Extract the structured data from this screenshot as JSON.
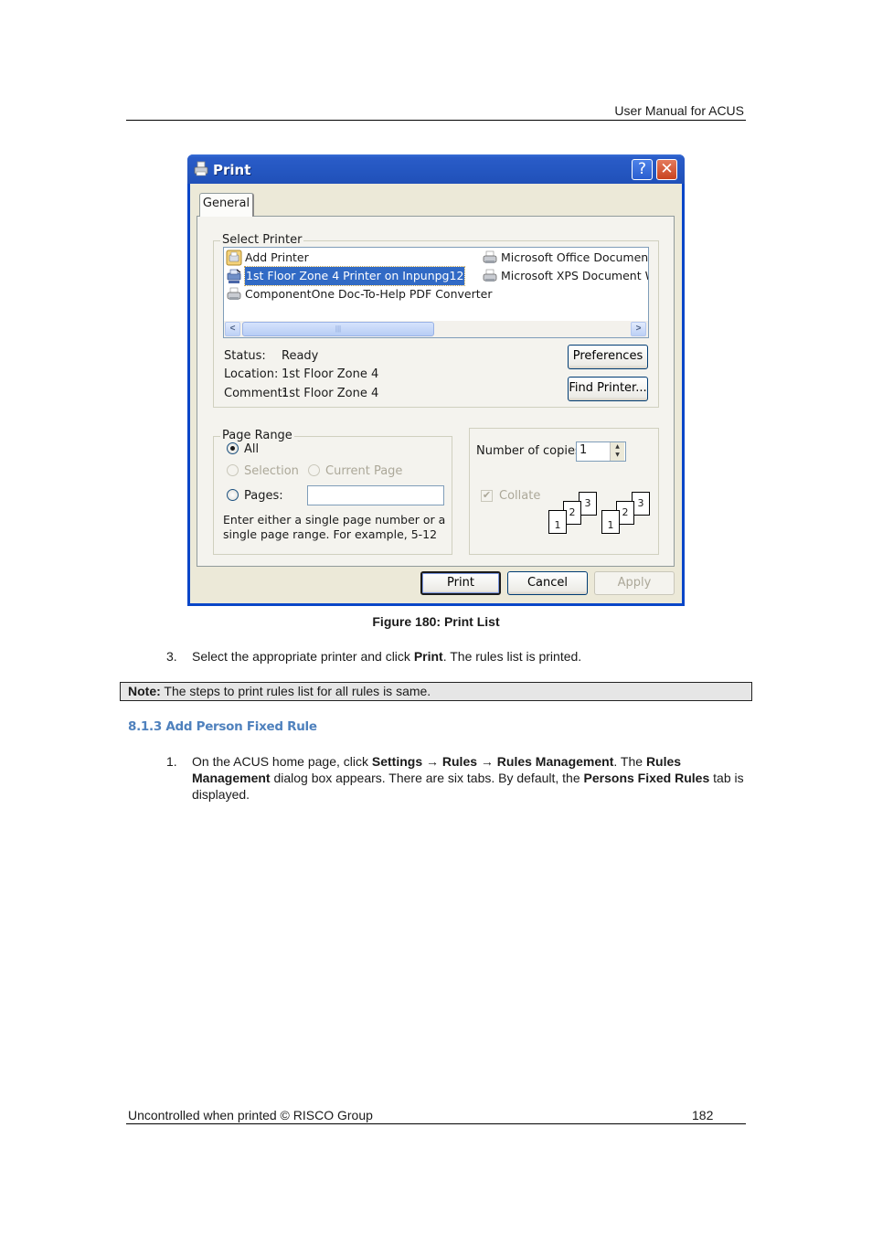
{
  "page_header": {
    "title": "User Manual for ACUS"
  },
  "dialog": {
    "title": "Print",
    "help_button": "?",
    "close_button": "✕",
    "tabs": [
      {
        "label": "General",
        "active": true
      }
    ],
    "select_printer": {
      "group_label": "Select Printer",
      "printers": [
        {
          "name": "Add Printer",
          "icon": "add-printer-icon",
          "selected": false
        },
        {
          "name": "1st Floor Zone 4 Printer on Inpunpg12",
          "icon": "network-printer-icon",
          "selected": true
        },
        {
          "name": "ComponentOne Doc-To-Help PDF Converter",
          "icon": "printer-icon",
          "selected": false
        },
        {
          "name": "Microsoft Office Document I",
          "icon": "printer-icon",
          "selected": false
        },
        {
          "name": "Microsoft XPS Document Wri",
          "icon": "printer-icon",
          "selected": false
        }
      ],
      "scroll_left": "<",
      "scroll_right": ">",
      "scroll_grip": "|||",
      "status_label": "Status:",
      "status_value": "Ready",
      "location_label": "Location:",
      "location_value": "1st Floor Zone 4",
      "comment_label": "Comment:",
      "comment_value": "1st Floor Zone 4",
      "preferences_button": "Preferences",
      "find_printer_button": "Find Printer..."
    },
    "page_range": {
      "group_label": "Page Range",
      "all_label": "All",
      "selection_label": "Selection",
      "current_page_label": "Current Page",
      "pages_label": "Pages:",
      "pages_value": "",
      "selected_option": "All",
      "hint": "Enter either a single page number or a single page range.  For example, 5-12"
    },
    "copies": {
      "number_label": "Number of copies:",
      "number_value": "1",
      "collate_label": "Collate",
      "collate_checked": true,
      "collate_enabled": false,
      "collate_pages": [
        "1",
        "2",
        "3"
      ]
    },
    "buttons": {
      "print": "Print",
      "cancel": "Cancel",
      "apply": "Apply"
    }
  },
  "figure_caption": "Figure 180: Print List",
  "step3": {
    "number": "3.",
    "text_before": "Select the appropriate printer and click ",
    "bold": "Print",
    "text_after": ". The rules list is printed."
  },
  "note": {
    "label": "Note:",
    "text": " The steps to print rules list for all rules is same."
  },
  "section_heading": "8.1.3 Add Person Fixed Rule",
  "step1": {
    "number": "1.",
    "parts": [
      {
        "t": "On the ACUS home page, click ",
        "b": false
      },
      {
        "t": "Settings",
        "b": true
      },
      {
        "t": " → ",
        "b": false
      },
      {
        "t": "Rules",
        "b": true
      },
      {
        "t": " → ",
        "b": false
      },
      {
        "t": "Rules Management",
        "b": true
      },
      {
        "t": ". The ",
        "b": false
      },
      {
        "t": "Rules Management",
        "b": true
      },
      {
        "t": " dialog box appears. There are six tabs. By default, the ",
        "b": false
      },
      {
        "t": "Persons Fixed Rules",
        "b": true
      },
      {
        "t": " tab is displayed.",
        "b": false
      }
    ]
  },
  "page_footer": {
    "left": "Uncontrolled when printed © RISCO Group",
    "page_number": "182"
  }
}
